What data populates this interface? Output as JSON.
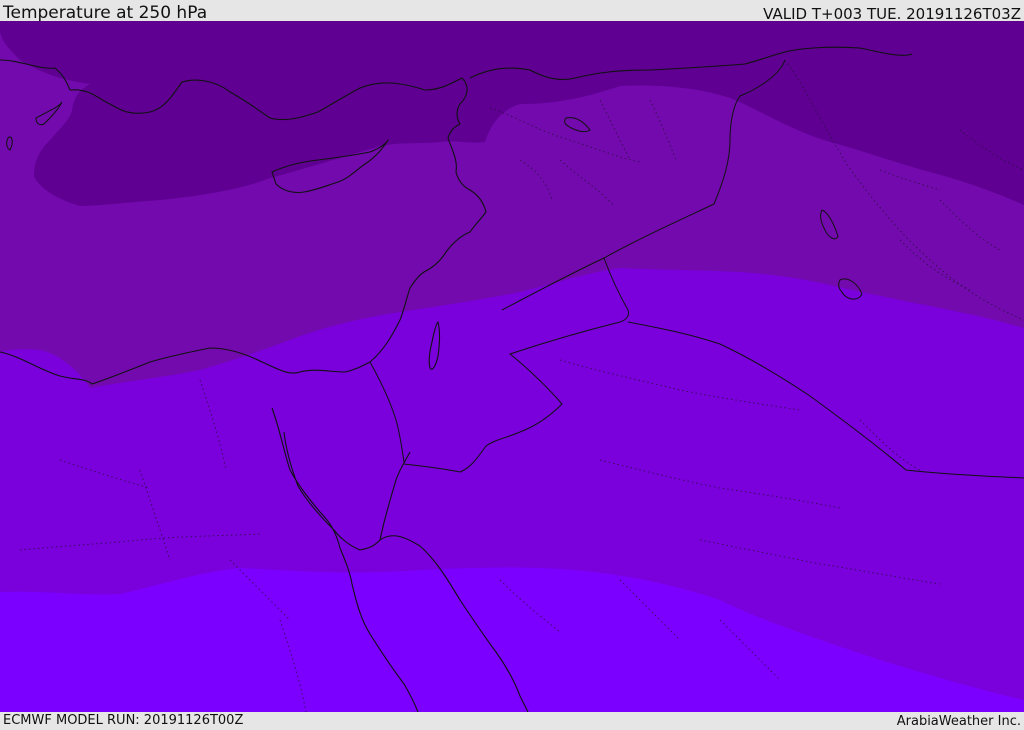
{
  "header": {
    "title": "Temperature at 250 hPa",
    "valid": "VALID T+003 TUE. 20191126T03Z"
  },
  "footer": {
    "model_run": "ECMWF MODEL RUN: 20191126T00Z",
    "credit": "ArabiaWeather Inc."
  },
  "map": {
    "colors": {
      "band_darkest": "#5f0092",
      "band_dark": "#730aad",
      "band_mid": "#7a00dc",
      "band_light": "#7c00ff",
      "coastline": "#111111"
    }
  }
}
